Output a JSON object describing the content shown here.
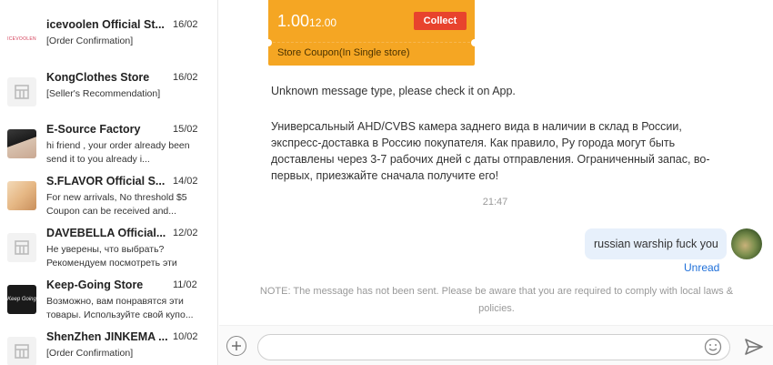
{
  "conversations": [
    {
      "name": "icevoolen Official St...",
      "date": "16/02",
      "preview": "[Order Confirmation]",
      "avatar": "icevoolen-logo",
      "avatar_text": "ICEVOOLEN"
    },
    {
      "name": "KongClothes Store",
      "date": "16/02",
      "preview": "[Seller's Recommendation]",
      "avatar": "store-icon"
    },
    {
      "name": "E-Source Factory",
      "date": "15/02",
      "preview": "hi friend , your order already been send it to you already i...",
      "avatar": "profile-photo"
    },
    {
      "name": "S.FLAVOR Official S...",
      "date": "14/02",
      "preview": "For new arrivals, No threshold $5 Coupon can be received and...",
      "avatar": "profile-photo"
    },
    {
      "name": "DAVEBELLA Official...",
      "date": "12/02",
      "preview": "Не уверены, что выбрать? Рекомендуем посмотреть эти товары",
      "avatar": "store-icon"
    },
    {
      "name": "Keep-Going Store",
      "date": "11/02",
      "preview": "Возможно, вам понравятся эти товары. Используйте свой купо...",
      "avatar": "keep-going-logo",
      "avatar_text": "Keep Going"
    },
    {
      "name": "ShenZhen JINKEMA ...",
      "date": "10/02",
      "preview": "[Order Confirmation]",
      "avatar": "store-icon"
    }
  ],
  "coupon": {
    "amount": "1.00",
    "min_spend": "12.00",
    "collect_label": "Collect",
    "type_label": "Store Coupon(In Single store)",
    "color": "#f5a623"
  },
  "messages": {
    "unknown": "Unknown message type, please check it on App.",
    "russian": "Универсальный AHD/CVBS камера заднего вида в наличии в склад в России, экспресс-доставка в Россию покупателя. Как правило, Ру города могут быть доставлены через 3-7 рабочих дней с даты отправления. Ограниченный запас, во-первых, приезжайте сначала получите его!",
    "time": "21:47",
    "outgoing": "russian warship fuck you",
    "status": "Unread",
    "note": "NOTE: The message has not been sent. Please be aware that you are required to comply with local laws & policies."
  },
  "input": {
    "placeholder": "",
    "value": ""
  },
  "icons": {
    "add": "plus-circle-icon",
    "emoji": "smiley-icon",
    "send": "send-arrow-icon"
  },
  "colors": {
    "accent_link": "#1e6fd9",
    "bubble": "#e7f0fb",
    "collect_button": "#e8432d"
  }
}
